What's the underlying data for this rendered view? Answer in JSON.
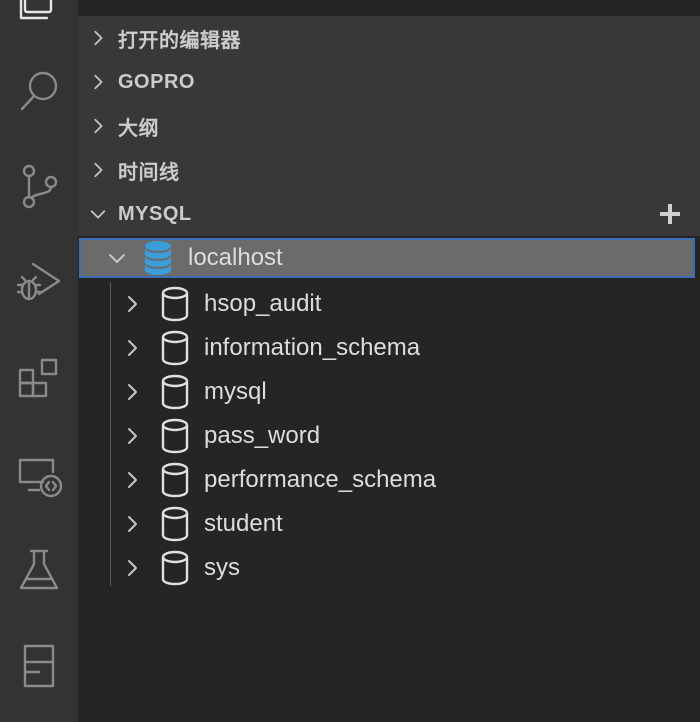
{
  "activity_bar": {
    "icons": [
      "explorer-icon",
      "search-icon",
      "source-control-icon",
      "run-debug-icon",
      "extensions-icon",
      "remote-explorer-icon",
      "testing-icon",
      "database-icon"
    ]
  },
  "sidebar": {
    "sections": [
      {
        "label": "打开的编辑器",
        "expanded": false
      },
      {
        "label": "GOPRO",
        "expanded": false
      },
      {
        "label": "大纲",
        "expanded": false
      },
      {
        "label": "时间线",
        "expanded": false
      },
      {
        "label": "MYSQL",
        "expanded": true
      }
    ],
    "connection": {
      "label": "localhost",
      "icon": "database-stack-icon",
      "color": "#3c9dd9"
    },
    "databases": [
      {
        "label": "hsop_audit"
      },
      {
        "label": "information_schema"
      },
      {
        "label": "mysql"
      },
      {
        "label": "pass_word"
      },
      {
        "label": "performance_schema"
      },
      {
        "label": "student"
      },
      {
        "label": "sys"
      }
    ]
  },
  "colors": {
    "activity_bar": "#333333",
    "sidebar": "#252526",
    "section_header": "#383838",
    "selection": "#6b6b6b",
    "focus_border": "#3b6fb5"
  }
}
